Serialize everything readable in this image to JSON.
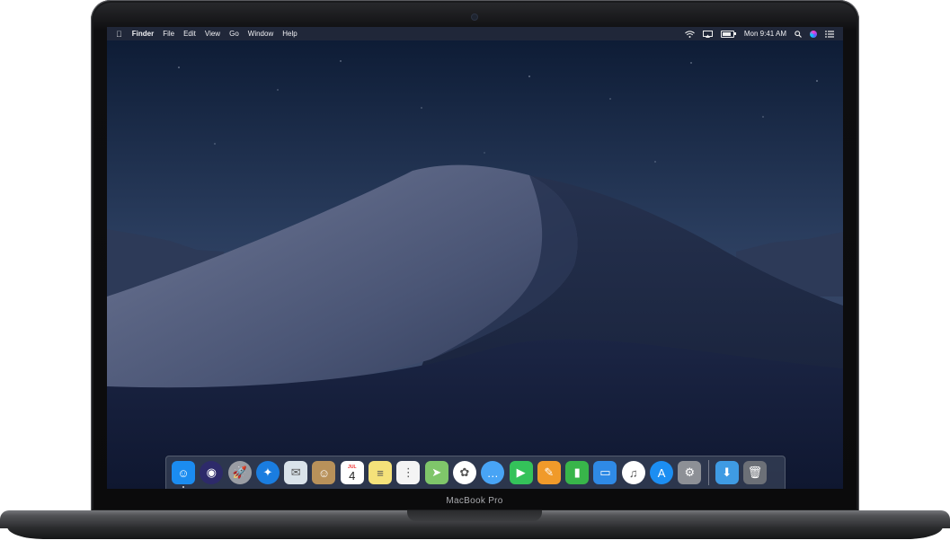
{
  "device": {
    "brand_label": "MacBook Pro"
  },
  "menubar": {
    "apple_icon": "apple-logo-icon",
    "app_name": "Finder",
    "menus": [
      "File",
      "Edit",
      "View",
      "Go",
      "Window",
      "Help"
    ],
    "status": {
      "wifi_icon": "wifi-icon",
      "airplay_icon": "airplay-icon",
      "battery_icon": "battery-icon",
      "clock": "Mon 9:41 AM",
      "spotlight_icon": "search-icon",
      "siri_icon": "siri-icon",
      "notification_icon": "notification-center-icon"
    }
  },
  "dock": {
    "apps": [
      {
        "name": "finder",
        "icon": "finder-icon",
        "color": "#1b8cf0",
        "glyph": "☺",
        "shape": "sq",
        "running": true
      },
      {
        "name": "siri",
        "icon": "siri-icon",
        "color": "#2d2a6a",
        "glyph": "◉",
        "shape": "round"
      },
      {
        "name": "launchpad",
        "icon": "launchpad-icon",
        "color": "#9a9da4",
        "glyph": "🚀",
        "shape": "round"
      },
      {
        "name": "safari",
        "icon": "safari-icon",
        "color": "#1a7de0",
        "glyph": "✦",
        "shape": "round"
      },
      {
        "name": "mail",
        "icon": "mail-icon",
        "color": "#d9e2ea",
        "glyph": "✉",
        "shape": "sq"
      },
      {
        "name": "contacts",
        "icon": "contacts-icon",
        "color": "#b8915a",
        "glyph": "☺",
        "shape": "sq"
      },
      {
        "name": "calendar",
        "icon": "calendar-icon",
        "color": "#ffffff",
        "glyph": "4",
        "shape": "sq",
        "month": "JUL"
      },
      {
        "name": "notes",
        "icon": "notes-icon",
        "color": "#f5e27a",
        "glyph": "≡",
        "shape": "sq"
      },
      {
        "name": "reminders",
        "icon": "reminders-icon",
        "color": "#f4f4f4",
        "glyph": "⋮",
        "shape": "sq"
      },
      {
        "name": "maps",
        "icon": "maps-icon",
        "color": "#7fc66a",
        "glyph": "➤",
        "shape": "sq"
      },
      {
        "name": "photos",
        "icon": "photos-icon",
        "color": "#ffffff",
        "glyph": "✿",
        "shape": "round"
      },
      {
        "name": "messages",
        "icon": "messages-icon",
        "color": "#48a4f5",
        "glyph": "…",
        "shape": "round"
      },
      {
        "name": "facetime",
        "icon": "facetime-icon",
        "color": "#34c25a",
        "glyph": "▶",
        "shape": "sq"
      },
      {
        "name": "pages",
        "icon": "pages-icon",
        "color": "#f09a2a",
        "glyph": "✎",
        "shape": "sq"
      },
      {
        "name": "numbers",
        "icon": "numbers-icon",
        "color": "#38b54a",
        "glyph": "▮",
        "shape": "sq"
      },
      {
        "name": "keynote",
        "icon": "keynote-icon",
        "color": "#2f8ae6",
        "glyph": "▭",
        "shape": "sq"
      },
      {
        "name": "itunes",
        "icon": "itunes-icon",
        "color": "#ffffff",
        "glyph": "♫",
        "shape": "round"
      },
      {
        "name": "app-store",
        "icon": "app-store-icon",
        "color": "#1c8ef2",
        "glyph": "A",
        "shape": "round"
      },
      {
        "name": "system-preferences",
        "icon": "gear-icon",
        "color": "#8d9096",
        "glyph": "⚙",
        "shape": "sq"
      }
    ],
    "extras": [
      {
        "name": "downloads",
        "icon": "downloads-folder-icon",
        "color": "#3f9be3",
        "glyph": "⬇",
        "shape": "sq"
      },
      {
        "name": "trash",
        "icon": "trash-icon",
        "color": "#6c7077",
        "glyph": "🗑",
        "shape": "sq"
      }
    ]
  }
}
